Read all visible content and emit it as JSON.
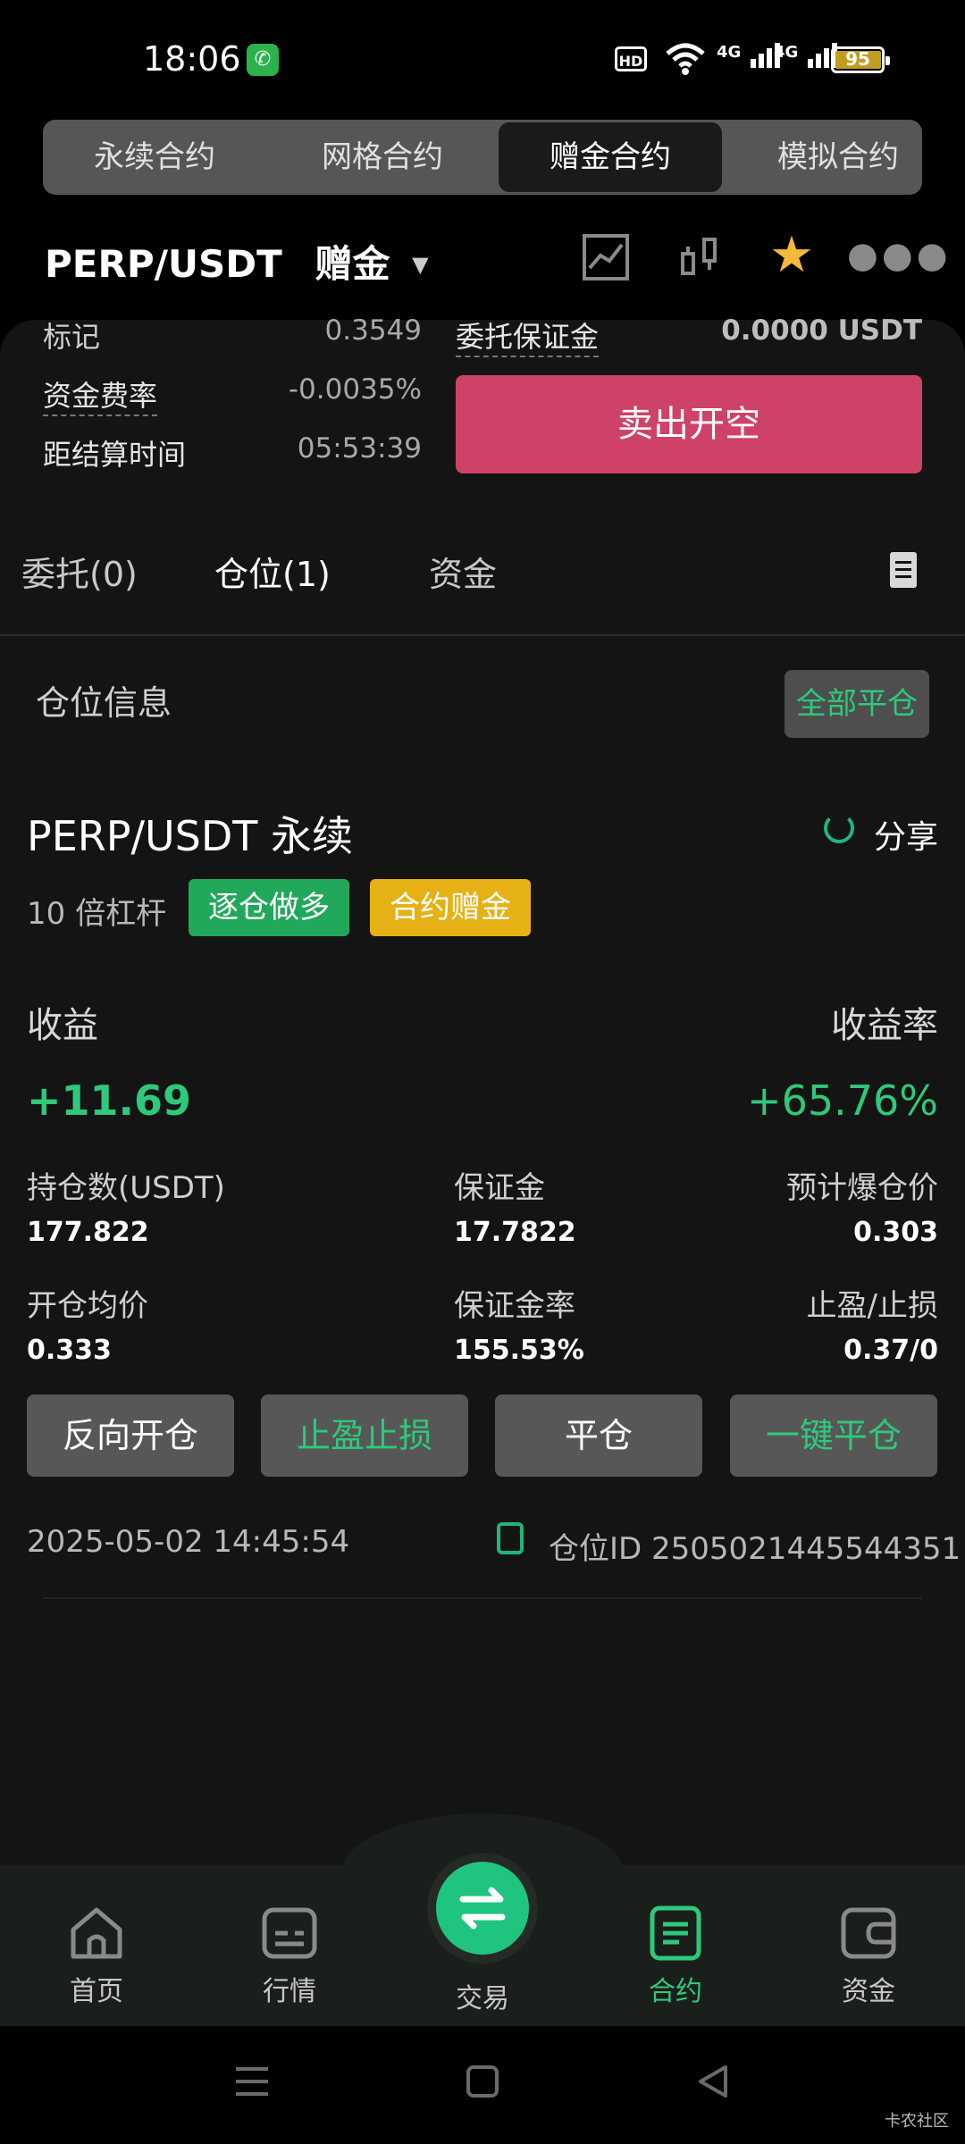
{
  "status_bar": {
    "time": "18:06",
    "hd_label": "HD",
    "network": [
      "4G",
      "4G"
    ],
    "battery": "95"
  },
  "segment_tabs": [
    "永续合约",
    "网格合约",
    "赠金合约",
    "模拟合约"
  ],
  "active_segment": "赠金合约",
  "pair": {
    "symbol": "PERP/USDT",
    "tag": "赠金",
    "caret": "▼"
  },
  "header_icons": [
    "chart-line-icon",
    "candlestick-icon",
    "star-icon",
    "more-icon"
  ],
  "market_info": {
    "mark_label": "标记",
    "mark_value": "0.3549",
    "funding_label": "资金费率",
    "funding_value": "-0.0035%",
    "settle_label": "距结算时间",
    "settle_value": "05:53:39",
    "order_margin_label": "委托保证金",
    "order_margin_value": "0.0000 USDT",
    "sell_button": "卖出开空"
  },
  "position_tabs": {
    "orders": "委托(0)",
    "positions": "仓位(1)",
    "funds": "资金"
  },
  "position_section": {
    "title": "仓位信息",
    "close_all": "全部平仓"
  },
  "position": {
    "symbol": "PERP/USDT 永续",
    "share": "分享",
    "leverage": "10 倍杠杆",
    "badge_side": "逐仓做多",
    "badge_bonus": "合约赠金",
    "pnl_label": "收益",
    "pnl_value": "+11.69",
    "roe_label": "收益率",
    "roe_value": "+65.76%",
    "size_label": "持仓数(USDT)",
    "size_value": "177.822",
    "margin_label": "保证金",
    "margin_value": "17.7822",
    "liq_label": "预计爆仓价",
    "liq_value": "0.303",
    "entry_label": "开仓均价",
    "entry_value": "0.333",
    "margin_ratio_label": "保证金率",
    "margin_ratio_value": "155.53%",
    "tpsl_label": "止盈/止损",
    "tpsl_value": "0.37/0",
    "actions": [
      "反向开仓",
      "止盈止损",
      "平仓",
      "一键平仓"
    ],
    "timestamp": "2025-05-02 14:45:54",
    "position_id": "仓位ID 2505021445544351"
  },
  "bottom_nav": {
    "home": "首页",
    "market": "行情",
    "trade": "交易",
    "contract": "合约",
    "assets": "资金",
    "active": "合约"
  },
  "watermark": "卡农社区",
  "colors": {
    "accent_green": "#2ec97a",
    "sell_red": "#cf4267",
    "bonus_yellow": "#e6b114",
    "star_gold": "#f5b838"
  }
}
